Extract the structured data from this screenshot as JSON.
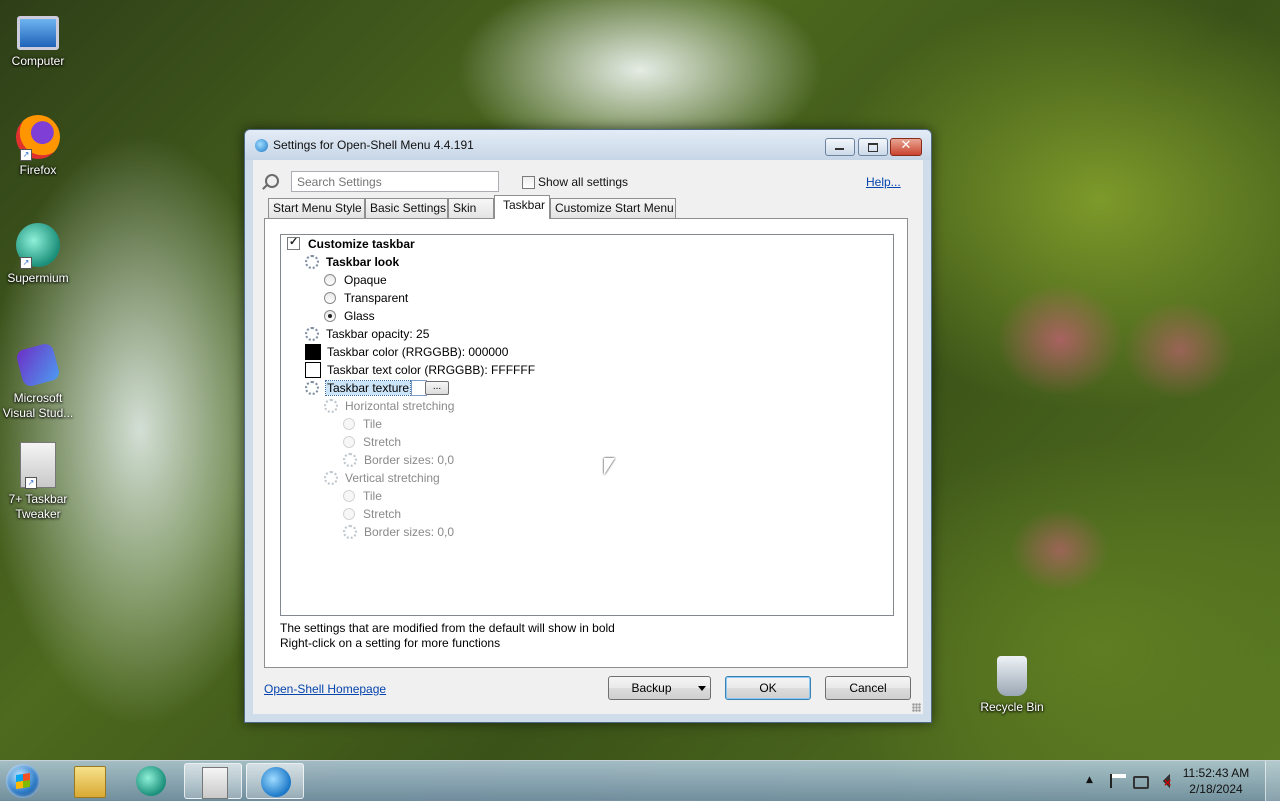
{
  "desktop": {
    "icons": [
      {
        "label": "Computer",
        "icon": "computer-icon"
      },
      {
        "label": "Firefox",
        "icon": "firefox-icon"
      },
      {
        "label": "Supermium",
        "icon": "supermium-icon"
      },
      {
        "label_line1": "Microsoft",
        "label_line2": "Visual Stud...",
        "icon": "visual-studio-icon"
      },
      {
        "label_line1": "7+ Taskbar",
        "label_line2": "Tweaker",
        "icon": "taskbar-tweaker-icon"
      },
      {
        "label": "Recycle Bin",
        "icon": "recycle-bin-icon"
      }
    ]
  },
  "window": {
    "title": "Settings for Open-Shell Menu 4.4.191",
    "search": {
      "placeholder": "Search Settings"
    },
    "show_all_label": "Show all settings",
    "help_link": "Help...",
    "tabs": [
      {
        "label": "Start Menu Style"
      },
      {
        "label": "Basic Settings"
      },
      {
        "label": "Skin"
      },
      {
        "label": "Taskbar",
        "active": true
      },
      {
        "label": "Customize Start Menu"
      }
    ],
    "tree": {
      "customize_taskbar": "Customize taskbar",
      "taskbar_look": "Taskbar look",
      "opaque": "Opaque",
      "transparent": "Transparent",
      "glass": "Glass",
      "opacity": "Taskbar opacity: 25",
      "color": "Taskbar color (RRGGBB): 000000",
      "text_color": "Taskbar text color (RRGGBB): FFFFFF",
      "texture": "Taskbar texture",
      "texture_button": "...",
      "horizontal_stretching": "Horizontal stretching",
      "h_tile": "Tile",
      "h_stretch": "Stretch",
      "h_border": "Border sizes: 0,0",
      "vertical_stretching": "Vertical stretching",
      "v_tile": "Tile",
      "v_stretch": "Stretch",
      "v_border": "Border sizes: 0,0"
    },
    "footnote_line1": "The settings that are modified from the default will show in bold",
    "footnote_line2": "Right-click on a setting for more functions",
    "homepage_link": "Open-Shell Homepage",
    "buttons": {
      "backup": "Backup",
      "ok": "OK",
      "cancel": "Cancel"
    },
    "colors": {
      "taskbar_color": "#000000",
      "taskbar_text_color": "#FFFFFF"
    }
  },
  "taskbar": {
    "clock_time": "11:52:43 AM",
    "clock_date": "2/18/2024",
    "tray_arrow": "▲"
  }
}
